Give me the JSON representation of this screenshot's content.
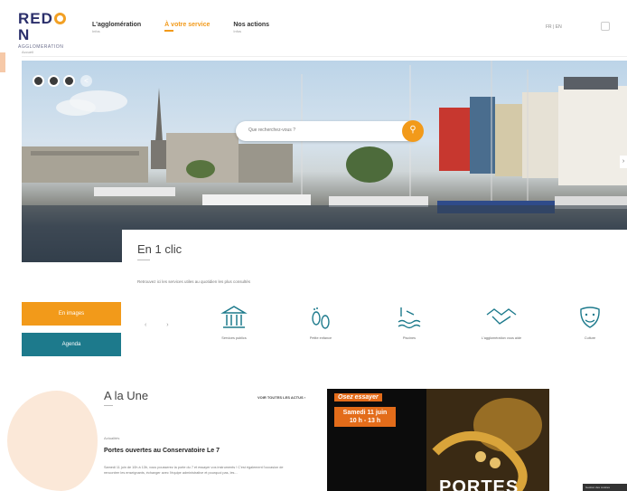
{
  "header": {
    "logo_text": "REDON",
    "logo_subtitle": "AGGLOMERATION",
    "nav": [
      {
        "label": "L'agglomération",
        "sub": "Infos"
      },
      {
        "label": "À votre service",
        "sub": "Infos"
      },
      {
        "label": "Nos actions",
        "sub": "Infos"
      }
    ],
    "lang": "FR | EN"
  },
  "breadcrumb": "Accueil",
  "search": {
    "placeholder": "Que recherchez-vous ?"
  },
  "clic": {
    "title": "En 1 clic",
    "description": "Retrouvez ici les services utiles au quotidien les plus consultés"
  },
  "quick_buttons": [
    {
      "label": "En images",
      "color": "#f29a1a"
    },
    {
      "label": "Agenda",
      "color": "#1d7a8c"
    }
  ],
  "shortcuts": [
    {
      "label": "Services publics",
      "icon": "building-icon"
    },
    {
      "label": "Petite enfance",
      "icon": "footprints-icon"
    },
    {
      "label": "Piscines",
      "icon": "pool-icon"
    },
    {
      "label": "L'agglomération vous aide",
      "icon": "handshake-icon"
    },
    {
      "label": "Culture",
      "icon": "theater-masks-icon"
    }
  ],
  "une": {
    "title": "A la Une",
    "link": "VOIR TOUTES LES ACTUS",
    "category": "Actualités",
    "headline": "Portes ouvertes au Conservatoire Le 7",
    "text": "Samedi 11 juin de 10h à 13h, vous pousserez la porte du 7 et essayer vos instruments ! C'est également l'occasion de rencontrer les enseignants, échanger avec l'équipe administrative et pourquoi pas, les..."
  },
  "poster": {
    "tag": "Osez essayer",
    "date_line1": "Samedi 11 juin",
    "date_line2": "10 h - 13 h",
    "big_text": "PORTES"
  },
  "cookie_bar": "Gestion des cookies",
  "colors": {
    "accent": "#f29a1a",
    "teal": "#1d7a8c",
    "brand": "#2b2f6b"
  }
}
